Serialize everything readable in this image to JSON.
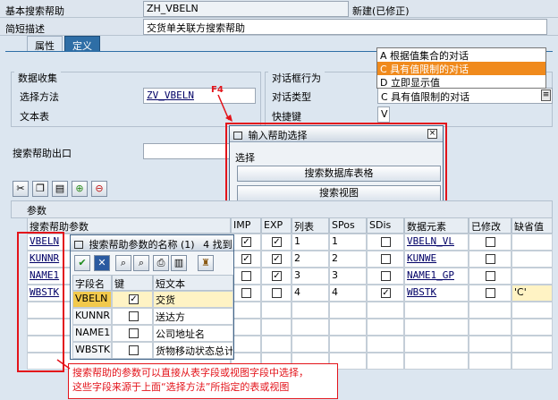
{
  "header": {
    "search_help_label": "基本搜索帮助",
    "search_help_name": "ZH_VBELN",
    "status": "新建(已修正)",
    "short_desc_label": "简短描述",
    "short_desc_value": "交货单关联方搜索帮助"
  },
  "tabs": [
    {
      "label": "属性"
    },
    {
      "label": "定义"
    }
  ],
  "data_collection": {
    "title": "数据收集",
    "selection_method_label": "选择方法",
    "selection_method_value": "ZV_VBELN",
    "text_table_label": "文本表",
    "f4_marker": "F4"
  },
  "dialog_behavior": {
    "title": "对话框行为",
    "dialog_type_label": "对话类型",
    "dialog_type_value": "C 具有值限制的对话",
    "hotkey_label": "快捷键",
    "hotkey_value": "V"
  },
  "dialog_dropdown": {
    "items": [
      {
        "label": "A 根据值集合的对话"
      },
      {
        "label": "C 具有值限制的对话"
      },
      {
        "label": "D 立即显示值"
      }
    ],
    "selected_index": 1
  },
  "exit": {
    "label": "搜索帮助出口"
  },
  "input_help_popup": {
    "title": "输入帮助选择",
    "group_label": "选择",
    "button_table": "搜索数据库表格",
    "button_view": "搜索视图"
  },
  "params_section": {
    "title": "参数",
    "columns": [
      "搜索帮助参数",
      "IMP",
      "EXP",
      "列表",
      "SPos",
      "SDis",
      "数据元素",
      "已修改",
      "缺省值"
    ],
    "rows": [
      {
        "param": "VBELN",
        "imp": true,
        "exp": true,
        "list": "1",
        "spos": "1",
        "sdis": false,
        "elem": "VBELN_VL",
        "mod": false,
        "default": ""
      },
      {
        "param": "KUNNR",
        "imp": true,
        "exp": true,
        "list": "2",
        "spos": "2",
        "sdis": false,
        "elem": "KUNWE",
        "mod": false,
        "default": ""
      },
      {
        "param": "NAME1",
        "imp": false,
        "exp": true,
        "list": "3",
        "spos": "3",
        "sdis": false,
        "elem": "NAME1_GP",
        "mod": false,
        "default": ""
      },
      {
        "param": "WBSTK",
        "imp": false,
        "exp": false,
        "list": "4",
        "spos": "4",
        "sdis": true,
        "elem": "WBSTK",
        "mod": false,
        "default": "'C'"
      }
    ]
  },
  "param_name_popup": {
    "title": "搜索帮助参数的名称 (1)",
    "count": "4 找到",
    "col_field": "字段名",
    "col_key": "键",
    "col_text": "短文本",
    "rows": [
      {
        "field": "VBELN",
        "key": true,
        "text": "交货"
      },
      {
        "field": "KUNNR",
        "key": false,
        "text": "送达方"
      },
      {
        "field": "NAME1",
        "key": false,
        "text": "公司地址名"
      },
      {
        "field": "WBSTK",
        "key": false,
        "text": "货物移动状态总计"
      }
    ]
  },
  "annotation": {
    "line1": "搜索帮助的参数可以直接从表字段或视图字段中选择，",
    "line2": "这些字段来源于上面“选择方法”所指定的表或视图"
  },
  "colors": {
    "accent_red": "#e3131a",
    "selection_orange": "#f08a1c",
    "row_highlight": "#fff3c4"
  }
}
